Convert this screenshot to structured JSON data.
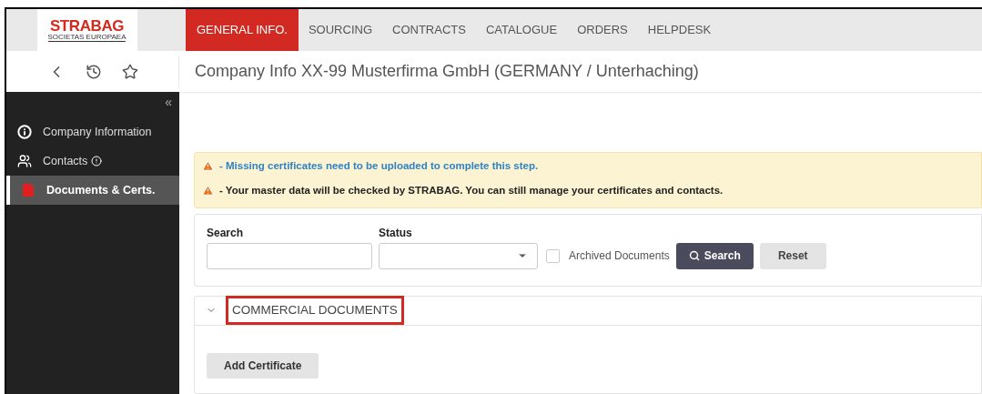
{
  "logo": {
    "name": "STRABAG",
    "tagline": "SOCIETAS EUROPAEA"
  },
  "nav_tabs": [
    {
      "label": "GENERAL INFO.",
      "selected": true
    },
    {
      "label": "SOURCING",
      "selected": false
    },
    {
      "label": "CONTRACTS",
      "selected": false
    },
    {
      "label": "CATALOGUE",
      "selected": false
    },
    {
      "label": "ORDERS",
      "selected": false
    },
    {
      "label": "HELPDESK",
      "selected": false
    }
  ],
  "page_title": "Company Info XX-99 Musterfirma GmbH (GERMANY / Unterhaching)",
  "sidebar": {
    "collapse": "«",
    "items": [
      {
        "label": "Company Information",
        "kind": "info",
        "selected": false,
        "has_notice": false
      },
      {
        "label": "Contacts",
        "kind": "people",
        "selected": false,
        "has_notice": true
      },
      {
        "label": "Documents & Certs.",
        "kind": "document",
        "selected": true,
        "has_notice": false
      }
    ]
  },
  "alerts": [
    {
      "text": "- Missing certificates need to be uploaded to complete this step.",
      "kind": "link"
    },
    {
      "text": "- Your master data will be checked by STRABAG. You can still manage your certificates and contacts.",
      "kind": "plain"
    }
  ],
  "filters": {
    "search_label": "Search",
    "status_label": "Status",
    "archived": {
      "label": "Archived Documents",
      "checked": false
    },
    "search_button": "Search",
    "reset_button": "Reset"
  },
  "section": {
    "title": "COMMERCIAL DOCUMENTS",
    "expanded": true,
    "highlighted": true,
    "add_button": "Add Certificate"
  }
}
